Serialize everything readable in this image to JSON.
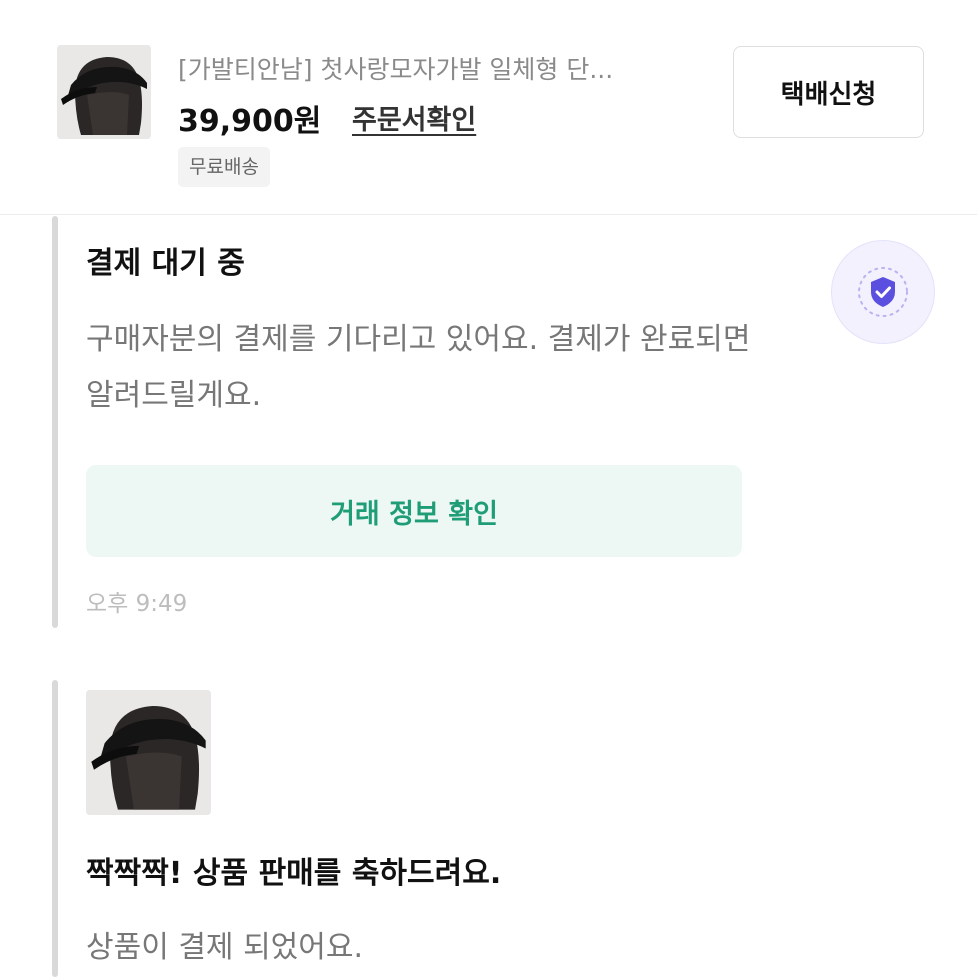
{
  "product": {
    "image_icon": "wig-cap-product-photo",
    "title": "[가발티안남] 첫사랑모자가발 일체형 단...",
    "price": "39,900원",
    "order_link": "주문서확인",
    "badge": "무료배송",
    "ship_button": "택배신청"
  },
  "messages": [
    {
      "title": "결제 대기 중",
      "body": "구매자분의 결제를 기다리고 있어요. 결제가 완료되면 알려드릴게요.",
      "button": "거래 정보 확인",
      "time": "오후 9:49",
      "icon": "shield-check-icon"
    },
    {
      "image_icon": "wig-cap-product-photo",
      "title": "짝짝짝! 상품 판매를 축하드려요.",
      "body": "상품이 결제 되었어요."
    }
  ],
  "colors": {
    "accent_green": "#1f9d77",
    "button_green_bg": "#edf8f5",
    "shield_purple": "#5b4fe0",
    "text_gray": "#777777"
  }
}
